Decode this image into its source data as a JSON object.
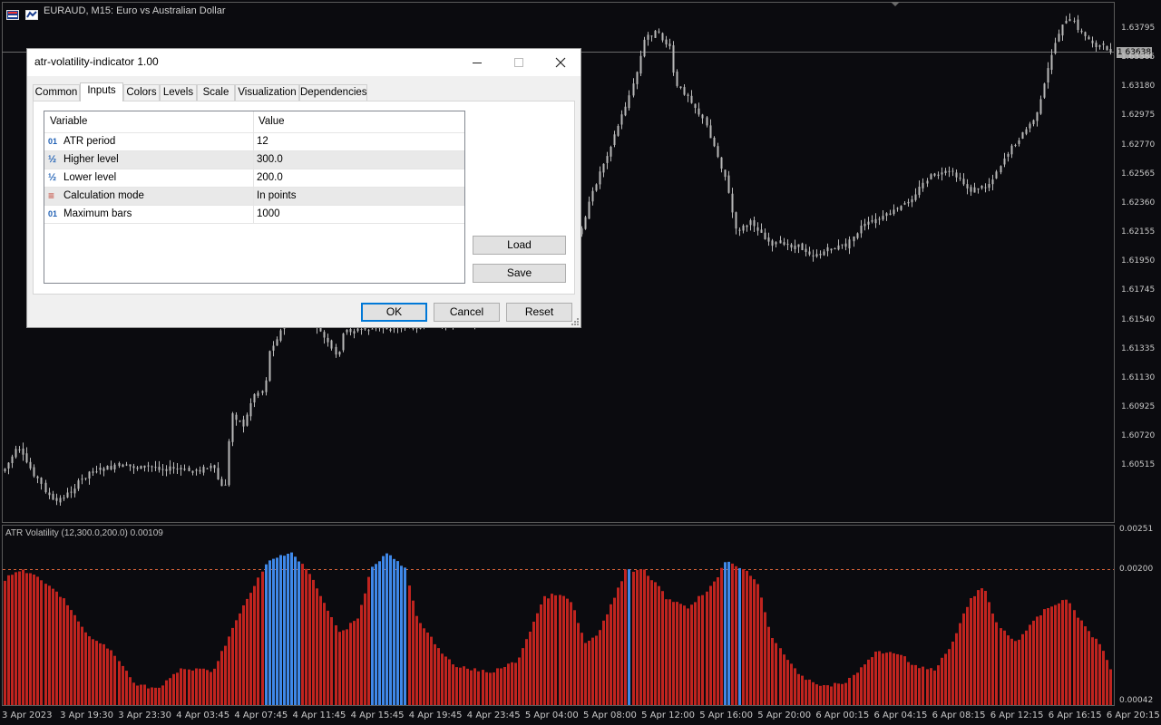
{
  "chart": {
    "symbol_title": "EURAUD, M15:  Euro vs Australian Dollar",
    "current_price": "1.63638",
    "price_axis": [
      "1.63795",
      "1.63385",
      "1.63180",
      "1.62975",
      "1.62770",
      "1.62565",
      "1.62360",
      "1.62155",
      "1.61950",
      "1.61745",
      "1.61540",
      "1.61335",
      "1.61130",
      "1.60925",
      "1.60720",
      "1.60515"
    ],
    "time_axis": [
      "3 Apr 2023",
      "3 Apr 19:30",
      "3 Apr 23:30",
      "4 Apr 03:45",
      "4 Apr 07:45",
      "4 Apr 11:45",
      "4 Apr 15:45",
      "4 Apr 19:45",
      "4 Apr 23:45",
      "5 Apr 04:00",
      "5 Apr 08:00",
      "5 Apr 12:00",
      "5 Apr 16:00",
      "5 Apr 20:00",
      "6 Apr 00:15",
      "6 Apr 04:15",
      "6 Apr 08:15",
      "6 Apr 12:15",
      "6 Apr 16:15",
      "6 Apr 20:15"
    ],
    "colors": {
      "background": "#0b0b0f",
      "candle": "#b8b8b8",
      "bar_normal": "#c0241f",
      "bar_high": "#3f88e8",
      "level_line": "#d9643a"
    }
  },
  "indicator": {
    "title": "ATR Volatility (12,300.0,200.0) 0.00109",
    "axis": [
      "0.00251",
      "0.00200",
      "0.00042"
    ]
  },
  "dialog": {
    "title": "atr-volatility-indicator 1.00",
    "minimize_icon": "minimize-icon",
    "maximize_icon": "maximize-icon",
    "close_icon": "close-icon",
    "tabs": [
      {
        "label": "Common",
        "active": false
      },
      {
        "label": "Inputs",
        "active": true
      },
      {
        "label": "Colors",
        "active": false
      },
      {
        "label": "Levels",
        "active": false
      },
      {
        "label": "Scale",
        "active": false
      },
      {
        "label": "Visualization",
        "active": false
      },
      {
        "label": "Dependencies",
        "active": false
      }
    ],
    "grid": {
      "col_variable": "Variable",
      "col_value": "Value",
      "rows": [
        {
          "icon": "01",
          "variable": "ATR period",
          "value": "12"
        },
        {
          "icon": "½",
          "variable": "Higher level",
          "value": "300.0"
        },
        {
          "icon": "½",
          "variable": "Lower level",
          "value": "200.0"
        },
        {
          "icon": "≡",
          "variable": "Calculation mode",
          "value": "In points"
        },
        {
          "icon": "01",
          "variable": "Maximum bars",
          "value": "1000"
        }
      ]
    },
    "buttons": {
      "load": "Load",
      "save": "Save",
      "ok": "OK",
      "cancel": "Cancel",
      "reset": "Reset"
    }
  }
}
